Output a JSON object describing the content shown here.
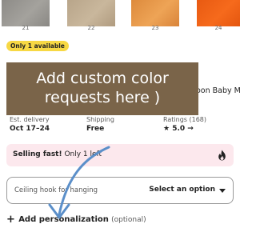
{
  "swatches": [
    {
      "number": "21",
      "color": "#9a9893"
    },
    {
      "number": "22",
      "color": "#c0ad92"
    },
    {
      "number": "23",
      "color": "#e8994a"
    },
    {
      "number": "24",
      "color": "#f2621a"
    }
  ],
  "badge": {
    "text": "Only 1 available",
    "color": "#f7d844"
  },
  "listing": {
    "title_fragment": "oon Baby M..."
  },
  "overlay": {
    "line1": "Add custom color",
    "line2": "requests here )",
    "color": "#7a6449"
  },
  "info": {
    "delivery": {
      "label": "Est. delivery",
      "value": "Oct 17–24"
    },
    "shipping": {
      "label": "Shipping",
      "value": "Free"
    },
    "ratings": {
      "label": "Ratings (168)",
      "star": "★",
      "value": "5.0 →"
    }
  },
  "selling": {
    "bold": "Selling fast!",
    "rest": " Only 1 left",
    "icon": "fire-icon",
    "background": "#fce8ed"
  },
  "option": {
    "label": "Ceiling hook for hanging",
    "value": "Select an option",
    "icon": "caret-down-icon"
  },
  "personalization": {
    "icon": "plus-icon",
    "label": "Add personalization",
    "note": "(optional)"
  },
  "annotation": {
    "arrow_color": "#5b8fc9"
  }
}
